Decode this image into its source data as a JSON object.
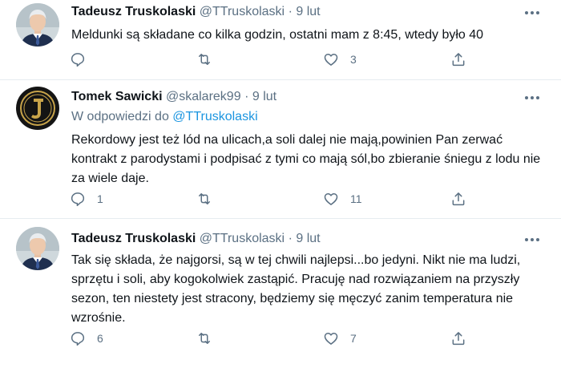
{
  "tweets": [
    {
      "name": "Tadeusz Truskolaski",
      "handle": "@TTruskolaski",
      "separator": "·",
      "date": "9 lut",
      "reply_prefix": "",
      "reply_handle": "",
      "text": "Meldunki są składane co kilka godzin, ostatni mam z 8:45, wtedy było 40",
      "replies": "",
      "retweets": "",
      "likes": "3"
    },
    {
      "name": "Tomek Sawicki",
      "handle": "@skalarek99",
      "separator": "·",
      "date": "9 lut",
      "reply_prefix": "W odpowiedzi do",
      "reply_handle": "@TTruskolaski",
      "text": "Rekordowy jest też lód na ulicach,a soli dalej nie mają,powinien Pan zerwać kontrakt z parodystami i podpisać z tymi co mają sól,bo zbieranie śniegu z lodu nie za wiele daje.",
      "replies": "1",
      "retweets": "",
      "likes": "11"
    },
    {
      "name": "Tadeusz Truskolaski",
      "handle": "@TTruskolaski",
      "separator": "·",
      "date": "9 lut",
      "reply_prefix": "",
      "reply_handle": "",
      "text": "Tak się składa, że najgorsi, są w tej chwili najlepsi...bo jedyni. Nikt nie ma ludzi, sprzętu i soli, aby kogokolwiek zastąpić. Pracuję nad rozwiązaniem na przyszły sezon, ten niestety jest stracony, będziemy się męczyć zanim temperatura nie wzrośnie.",
      "replies": "6",
      "retweets": "",
      "likes": "7"
    }
  ],
  "icons": {
    "reply": "speech-bubble-icon",
    "retweet": "retweet-arrows-icon",
    "like": "heart-icon",
    "share": "share-upload-icon",
    "more": "more-dots-icon"
  },
  "colors": {
    "name": "#0f1419",
    "secondary": "#5b7083",
    "link": "#1b95e0",
    "divider": "#e6ecf0",
    "avatar_seal_bg": "#141414",
    "avatar_seal_gold": "#c8a44a"
  }
}
